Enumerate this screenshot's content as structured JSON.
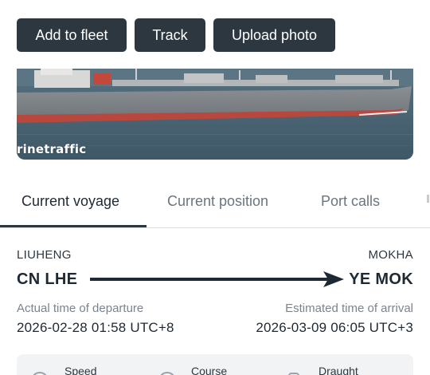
{
  "actions": {
    "add_to_fleet": "Add to fleet",
    "track": "Track",
    "upload_photo": "Upload photo"
  },
  "photo": {
    "watermark": "rinetraffic"
  },
  "tabs": [
    {
      "label": "Current voyage",
      "active": true
    },
    {
      "label": "Current position",
      "active": false
    },
    {
      "label": "Port calls",
      "active": false
    }
  ],
  "voyage": {
    "origin": {
      "port": "LIUHENG",
      "locode": "CN LHE"
    },
    "destination": {
      "port": "MOKHA",
      "locode": "YE MOK"
    },
    "departure": {
      "label": "Actual time of departure",
      "value": "2026-02-28 01:58 UTC+8"
    },
    "arrival": {
      "label": "Estimated time of arrival",
      "value": "2026-03-09 06:05 UTC+3"
    }
  },
  "stats": [
    {
      "label": "Speed",
      "icon": "speed-icon"
    },
    {
      "label": "Course",
      "icon": "course-icon"
    },
    {
      "label": "Draught",
      "icon": "draught-icon"
    }
  ],
  "colors": {
    "button_bg": "#2d3740",
    "text_primary": "#1f2933",
    "text_muted": "#7a848e",
    "hull_red": "#b8473e",
    "sea": "#46606f"
  }
}
